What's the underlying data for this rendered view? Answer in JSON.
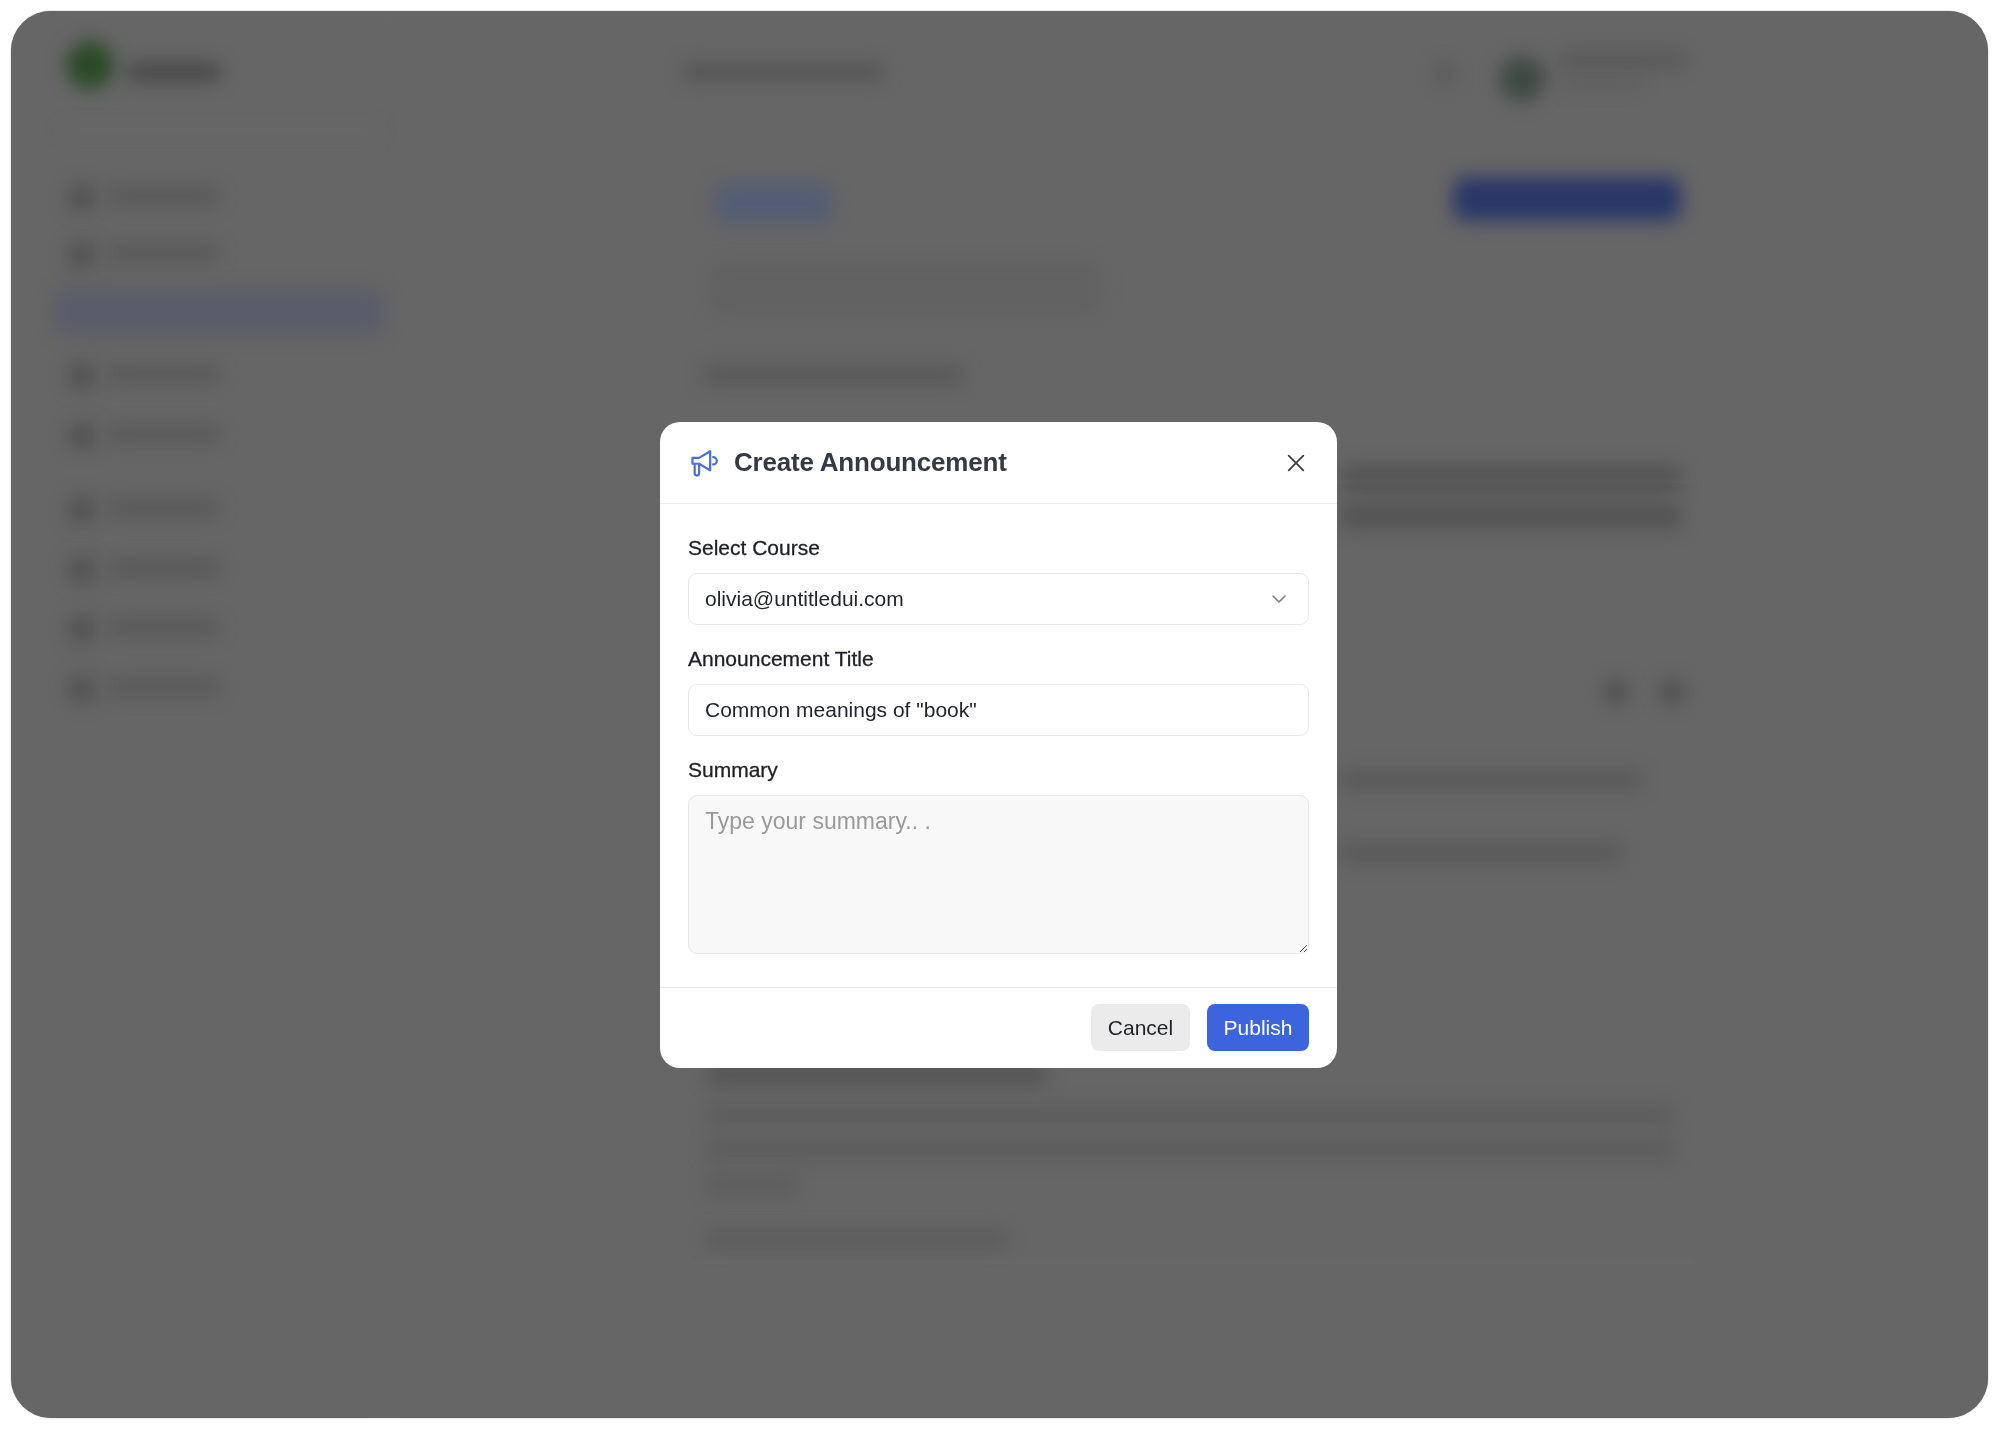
{
  "dialog": {
    "title": "Create Announcement",
    "fields": [
      {
        "kind": "select",
        "label": "Select Course",
        "value": "olivia@untitledui.com"
      },
      {
        "kind": "text",
        "label": "Announcement Title",
        "value": "Common meanings of \"book\""
      },
      {
        "kind": "textarea",
        "label": "Summary",
        "placeholder": "Type your summary.. ."
      }
    ],
    "buttons": [
      {
        "kind": "secondary",
        "label": "Cancel"
      },
      {
        "kind": "primary",
        "label": "Publish"
      }
    ]
  }
}
